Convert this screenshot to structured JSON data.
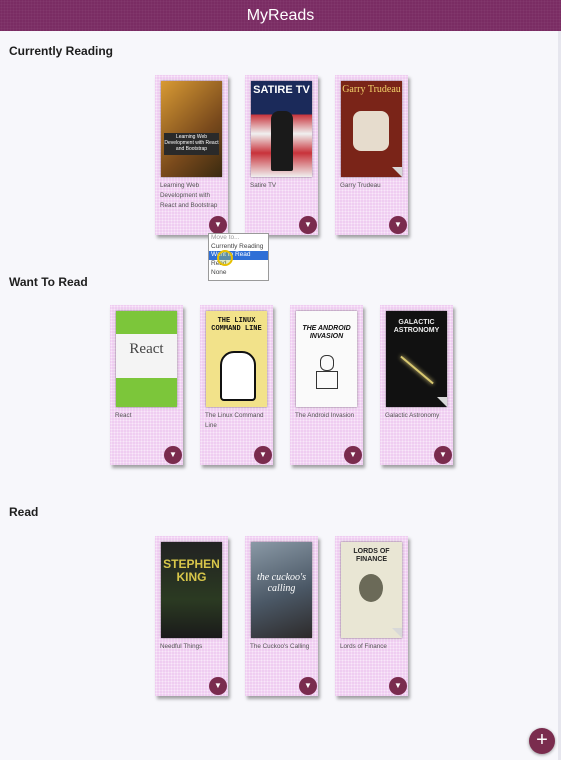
{
  "app": {
    "title": "MyReads"
  },
  "shelves": [
    {
      "title": "Currently Reading",
      "books": [
        {
          "title": "Learning Web Development with React and Bootstrap",
          "cover_text": "Learning Web Development with React and Bootstrap",
          "cover_color": "#6e3e18"
        },
        {
          "title": "Satire TV",
          "cover_text": "SATIRE TV",
          "cover_color": "#1b2a5a"
        },
        {
          "title": "Garry Trudeau",
          "cover_text": "Garry Trudeau",
          "cover_color": "#7a2418"
        }
      ]
    },
    {
      "title": "Want To Read",
      "books": [
        {
          "title": "React",
          "cover_text": "React",
          "cover_color": "#f2f2f2"
        },
        {
          "title": "The Linux Command Line",
          "cover_text": "THE LINUX COMMAND LINE",
          "cover_color": "#f2e28a"
        },
        {
          "title": "The Android Invasion",
          "cover_text": "THE ANDROID INVASION",
          "cover_color": "#fafafa"
        },
        {
          "title": "Galactic Astronomy",
          "cover_text": "GALACTIC ASTRONOMY",
          "cover_color": "#111111"
        }
      ]
    },
    {
      "title": "Read",
      "books": [
        {
          "title": "Needful Things",
          "cover_text": "STEPHEN KING",
          "cover_color": "#1f2a1c"
        },
        {
          "title": "The Cuckoo's Calling",
          "cover_text": "the cuckoo's calling",
          "cover_color": "#5a6a78"
        },
        {
          "title": "Lords of Finance",
          "cover_text": "LORDS OF FINANCE",
          "cover_color": "#e9e6d4"
        }
      ]
    }
  ],
  "shelf_menu": {
    "options": [
      "Move to...",
      "Currently Reading",
      "Want to Read",
      "Read",
      "None"
    ],
    "selected": "Want to Read"
  },
  "icons": {
    "changer": "triangle-down-icon",
    "add": "plus-icon"
  },
  "add_button_label": "+"
}
